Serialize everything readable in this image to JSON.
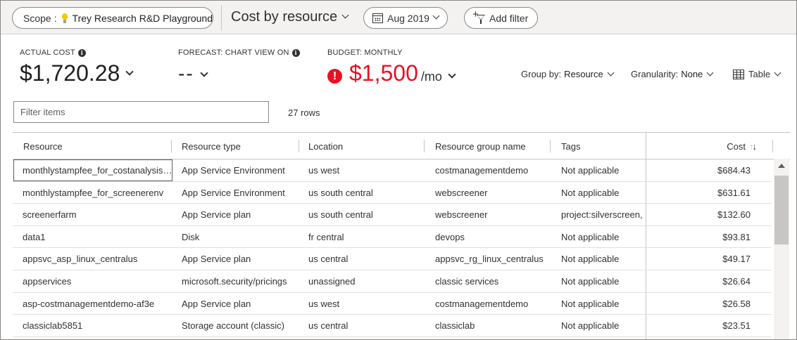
{
  "toolbar": {
    "scope_label": "Scope",
    "scope_separator": ":",
    "scope_name": "Trey Research R&D Playground",
    "view_title": "Cost by resource",
    "date_range": "Aug 2019",
    "add_filter": "Add filter"
  },
  "kpis": {
    "actual": {
      "label": "ACTUAL COST",
      "value": "$1,720.28"
    },
    "forecast": {
      "label": "FORECAST: CHART VIEW ON",
      "value": "--"
    },
    "budget": {
      "label": "BUDGET: MONTHLY",
      "value": "$1,500",
      "unit": "/mo",
      "status_icon": "error-icon",
      "status_color": "#e81123"
    }
  },
  "controls": {
    "group_by_label": "Group by:",
    "group_by_value": "Resource",
    "granularity_label": "Granularity:",
    "granularity_value": "None",
    "view_mode": "Table"
  },
  "filter": {
    "placeholder": "Filter items",
    "row_count": "27 rows"
  },
  "table": {
    "columns": [
      "Resource",
      "Resource type",
      "Location",
      "Resource group name",
      "Tags",
      "Cost"
    ],
    "sort_column": "Cost",
    "rows": [
      [
        "monthlystampfee_for_costanalysisenv",
        "App Service Environment",
        "us west",
        "costmanagementdemo",
        "Not applicable",
        "$684.43"
      ],
      [
        "monthlystampfee_for_screenerenv",
        "App Service Environment",
        "us south central",
        "webscreener",
        "Not applicable",
        "$631.61"
      ],
      [
        "screenerfarm",
        "App Service plan",
        "us south central",
        "webscreener",
        "project:silverscreen, env:prod",
        "$132.60"
      ],
      [
        "data1",
        "Disk",
        "fr central",
        "devops",
        "Not applicable",
        "$93.81"
      ],
      [
        "appsvc_asp_linux_centralus",
        "App Service plan",
        "us central",
        "appsvc_rg_linux_centralus",
        "Not applicable",
        "$49.17"
      ],
      [
        "appservices",
        "microsoft.security/pricings",
        "unassigned",
        "classic services",
        "Not applicable",
        "$26.64"
      ],
      [
        "asp-costmanagementdemo-af3e",
        "App Service plan",
        "us west",
        "costmanagementdemo",
        "Not applicable",
        "$26.58"
      ],
      [
        "classiclab5851",
        "Storage account (classic)",
        "us central",
        "classiclab",
        "Not applicable",
        "$23.51"
      ]
    ]
  }
}
